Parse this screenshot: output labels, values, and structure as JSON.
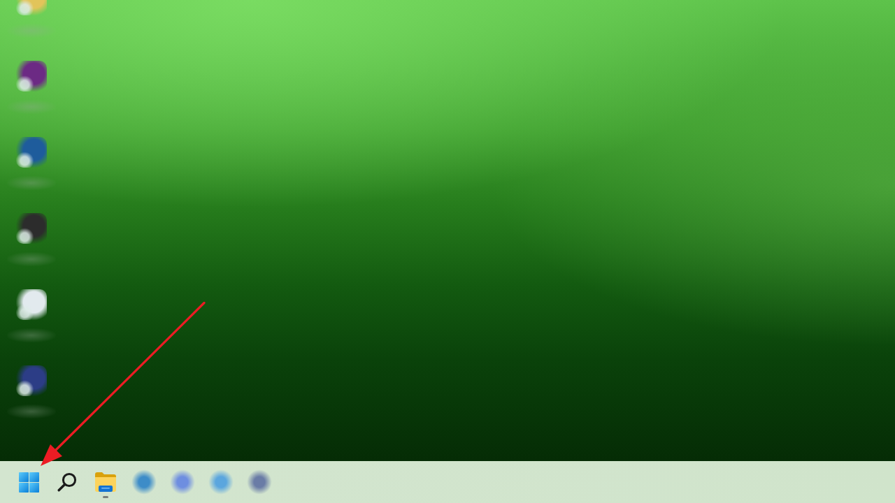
{
  "desktop": {
    "icons": [
      {
        "color": "#e2c45a"
      },
      {
        "color": "#6c2a84"
      },
      {
        "color": "#1e5c9c"
      },
      {
        "color": "#2c2c2c"
      },
      {
        "color": "#e2eaee"
      },
      {
        "color": "#2c3d86"
      }
    ]
  },
  "taskbar": {
    "items": [
      {
        "kind": "start",
        "running": false
      },
      {
        "kind": "search",
        "running": false
      },
      {
        "kind": "folder",
        "running": true
      },
      {
        "kind": "app",
        "color": "#3d8cc8",
        "running": false
      },
      {
        "kind": "app",
        "color": "#6e8ee0",
        "running": false
      },
      {
        "kind": "app",
        "color": "#5ba6de",
        "running": false
      },
      {
        "kind": "app",
        "color": "#6a7ca6",
        "running": false
      }
    ]
  },
  "annotations": [
    {
      "kind": "arrow"
    }
  ]
}
